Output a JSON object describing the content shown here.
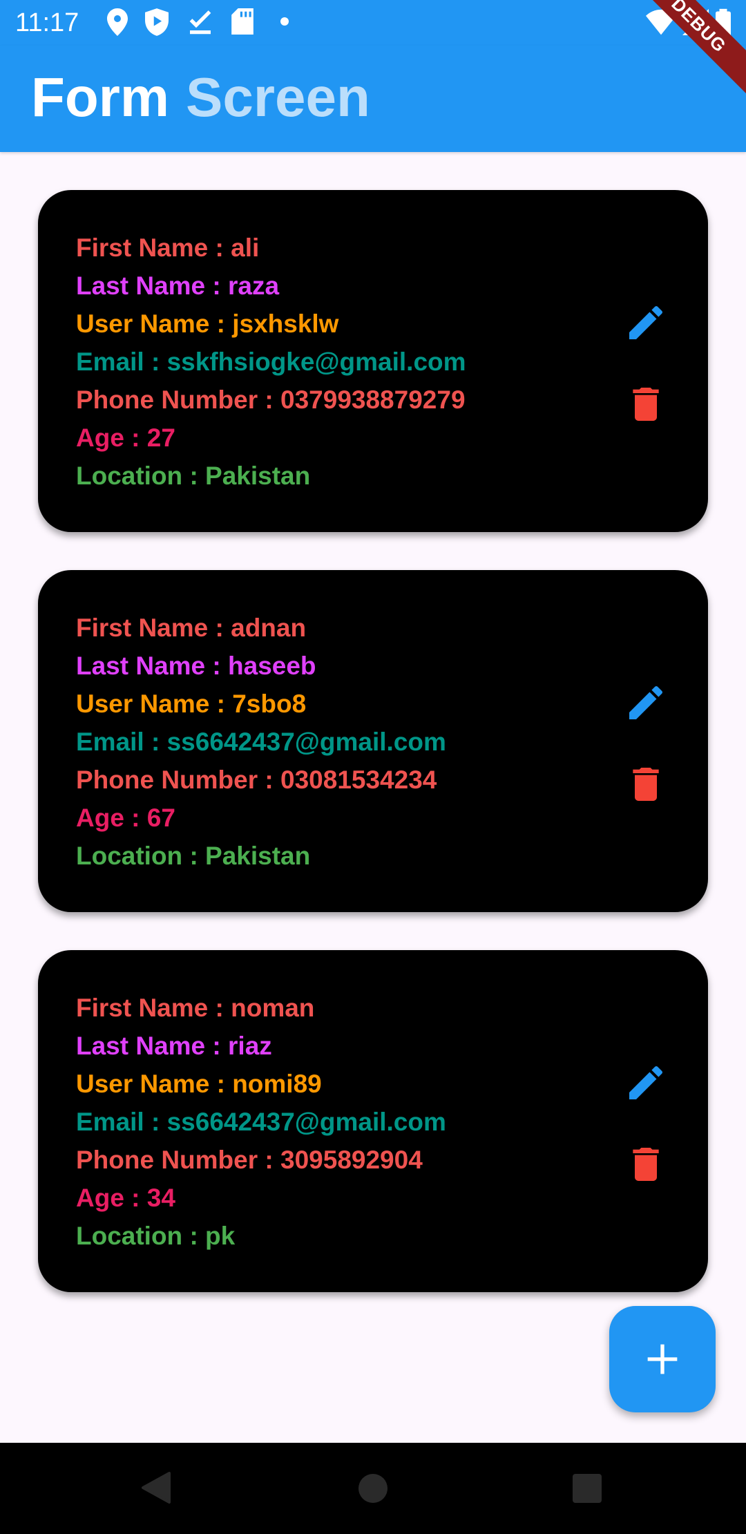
{
  "status_bar": {
    "time": "11:17",
    "icons": [
      "location-icon",
      "shield-play-icon",
      "checkmark-icon",
      "sd-card-icon",
      "dot-icon",
      "wifi-icon",
      "signal-icon",
      "battery-icon"
    ]
  },
  "app_bar": {
    "title_word1": "Form",
    "title_word2": "Screen",
    "debug_label": "DEBUG",
    "color": "#2196F3"
  },
  "entries": [
    {
      "first_name": "First Name : ali",
      "last_name": "Last Name : raza",
      "user_name": "User Name : jsxhsklw",
      "email": "Email : sskfhsiogke@gmail.com",
      "phone": "Phone Number : 0379938879279",
      "age": "Age : 27",
      "location": "Location : Pakistan"
    },
    {
      "first_name": "First Name : adnan",
      "last_name": "Last Name : haseeb",
      "user_name": "User Name : 7sbo8",
      "email": "Email : ss6642437@gmail.com",
      "phone": "Phone Number : 03081534234",
      "age": "Age : 67",
      "location": "Location : Pakistan"
    },
    {
      "first_name": "First Name : noman",
      "last_name": "Last Name : riaz",
      "user_name": "User Name : nomi89",
      "email": "Email : ss6642437@gmail.com",
      "phone": "Phone Number : 3095892904",
      "age": "Age : 34",
      "location": "Location : pk"
    }
  ],
  "icons": {
    "edit": "edit-icon",
    "delete": "delete-icon",
    "fab": "add-icon"
  },
  "colors": {
    "first_name": "#EF5350",
    "last_name": "#E040FB",
    "user_name": "#FF9800",
    "email": "#009688",
    "phone": "#EF5350",
    "age": "#E91E63",
    "location": "#4CAF50",
    "edit_icon": "#2196F3",
    "delete_icon": "#F44336",
    "card_background": "#000000",
    "page_background": "#FDF7FE"
  }
}
